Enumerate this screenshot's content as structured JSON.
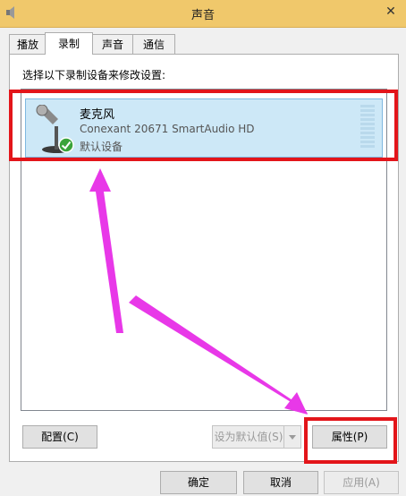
{
  "window": {
    "title": "声音",
    "close_label": "✕",
    "icon": "speaker-icon"
  },
  "tabs": [
    {
      "label": "播放"
    },
    {
      "label": "录制"
    },
    {
      "label": "声音"
    },
    {
      "label": "通信"
    }
  ],
  "instruction": "选择以下录制设备来修改设置:",
  "device": {
    "name": "麦克风",
    "description": "Conexant 20671 SmartAudio HD",
    "status": "默认设备",
    "icon": "microphone-icon",
    "status_icon": "checkmark-icon"
  },
  "buttons": {
    "configure": "配置(C)",
    "set_default": "设为默认值(S)",
    "properties": "属性(P)",
    "ok": "确定",
    "cancel": "取消",
    "apply": "应用(A)"
  },
  "colors": {
    "highlight": "#e3151a",
    "arrow": "#e838e8",
    "selection": "#cde8f7"
  }
}
